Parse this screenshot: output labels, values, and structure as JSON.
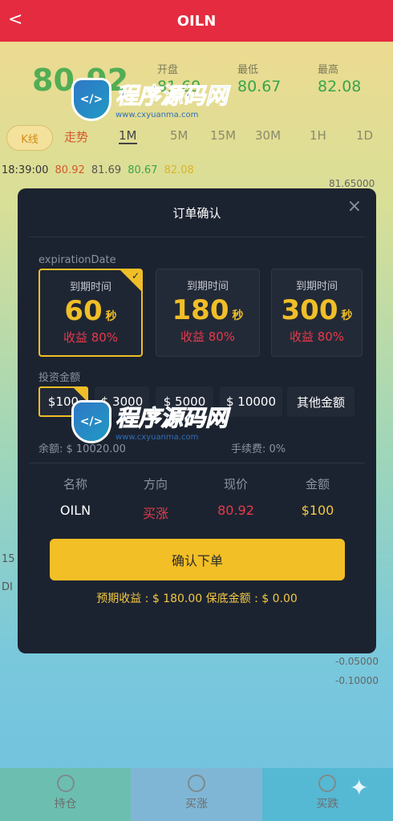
{
  "header": {
    "back": "<",
    "title": "OILN"
  },
  "price": {
    "current": "80.92",
    "open_label": "开盘",
    "open": "81.69",
    "low_label": "最低",
    "low": "80.67",
    "high_label": "最高",
    "high": "82.08"
  },
  "periods": [
    "K线",
    "走势",
    "1M",
    "5M",
    "15M",
    "30M",
    "1H",
    "1D"
  ],
  "ticker": [
    "18:39:00",
    "80.92",
    "81.69",
    "80.67",
    "82.08"
  ],
  "bg_axis": {
    "top": "81.65000",
    "v1": "-0.05000",
    "v2": "-0.10000"
  },
  "bg_side": {
    "a": "15",
    "b": "DI"
  },
  "modal": {
    "title": "订单确认",
    "close": "×",
    "expiration_label": "expirationDate",
    "cards": [
      {
        "label": "到期时间",
        "num": "60",
        "unit": "秒",
        "ret": "收益 80%"
      },
      {
        "label": "到期时间",
        "num": "180",
        "unit": "秒",
        "ret": "收益 80%"
      },
      {
        "label": "到期时间",
        "num": "300",
        "unit": "秒",
        "ret": "收益 80%"
      }
    ],
    "invest_label": "投资金额",
    "amounts": [
      "$100",
      "$ 3000",
      "$ 5000",
      "$ 10000",
      "其他金额"
    ],
    "balance": "余额: $ 10020.00",
    "fee": "手续费: 0%",
    "table_head": [
      "名称",
      "方向",
      "现价",
      "金额"
    ],
    "table_row": [
      "OILN",
      "买涨",
      "80.92",
      "$100"
    ],
    "confirm": "确认下单",
    "expect": "预期收益 : $ 180.00    保底金额 : $ 0.00"
  },
  "tabs": [
    "持仓",
    "买涨",
    "买跌"
  ],
  "watermark": {
    "cn": "程序源码网",
    "url": "www.cxyuanma.com"
  },
  "colors": {
    "header": "#e52b3f",
    "accent": "#f3bf26",
    "rise": "#e8394b",
    "green": "#38a54a"
  }
}
